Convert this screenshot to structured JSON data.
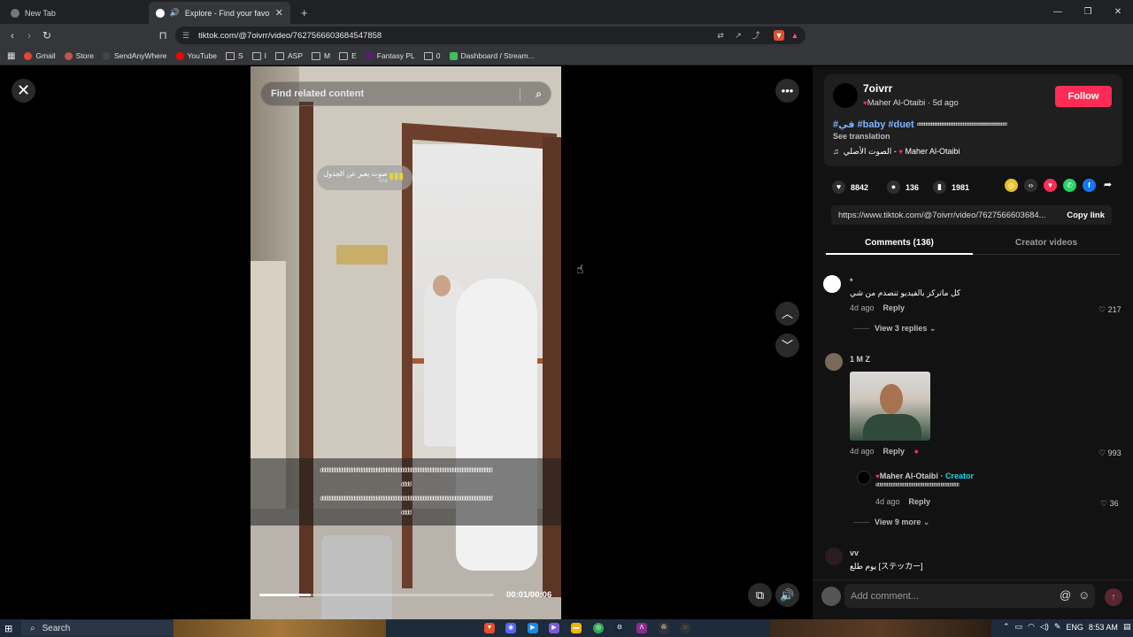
{
  "browser": {
    "tabs": [
      {
        "title": "New Tab"
      },
      {
        "title": "Explore - Find your favourite",
        "close": "✕"
      }
    ],
    "new_tab": "+",
    "url": "tiktok.com/@7oivrr/video/7627566603684547858",
    "bookmarks": [
      "Gmail",
      "Store",
      "SendAnyWhere",
      "YouTube",
      "S",
      "I",
      "ASP",
      "M",
      "E",
      "Fantasy PL",
      "0",
      "Dashboard / Stream..."
    ]
  },
  "video": {
    "search_placeholder": "Find related content",
    "sound_badge_text": "صوت يعبر عن الجدول",
    "sound_badge_sub": "ASA",
    "caption_line1": "ᵈᵈᵈᵈᵈᵈᵈᵈᵈᵈᵈᵈᵈᵈᵈᵈᵈᵈᵈᵈᵈᵈᵈᵈᵈᵈᵈᵈᵈᵈᵈᵈᵈᵈᵈᵈᵈᵈᵈᵈᵈᵈᵈᵈᵈᵈᵈᵈᵈᵈᵈᵈᵈᵈᵈᵈᵈᵈᵈᵈᵈᵈᵈᵈᵈᵈᵈᵈᵈᵈ",
    "caption_line2": "ᵈᵈᵈᵈ",
    "caption_line3": "ᵈᵈᵈᵈᵈᵈᵈᵈᵈᵈᵈᵈᵈᵈᵈᵈᵈᵈᵈᵈᵈᵈᵈᵈᵈᵈᵈᵈᵈᵈᵈᵈᵈᵈᵈᵈᵈᵈᵈᵈᵈᵈᵈᵈᵈᵈᵈᵈᵈᵈᵈᵈᵈᵈᵈᵈᵈᵈᵈᵈᵈᵈᵈᵈᵈᵈᵈᵈᵈᵈ",
    "caption_line4": "ᵈᵈᵈᵈ",
    "time": "00:01/00:06",
    "progress_fraction": 0.22
  },
  "post": {
    "username": "7oivrr",
    "nickname": "Maher Al-Otaibi",
    "age": "5d ago",
    "follow_label": "Follow",
    "hashtags": "#قي #baby #duet",
    "desc_tail": "ᵈᵈᵈᵈᵈᵈᵈᵈᵈᵈᵈᵈᵈᵈᵈᵈᵈᵈᵈᵈᵈᵈᵈᵈᵈᵈᵈᵈᵈᵈᵈᵈᵈᵈᵈᵈᵈᵈᵈᵈᵈᵈᵈᵈᵈᵈᵈᵈᵈᵈ",
    "see_translation": "See translation",
    "music_original": "الصوت الأصلي",
    "music_author": "Maher Al-Otaibi",
    "likes": "8842",
    "comments": "136",
    "saves": "1981",
    "link": "https://www.tiktok.com/@7oivrr/video/7627566603684...",
    "copy_link": "Copy link"
  },
  "tabs": {
    "comments": "Comments (136)",
    "creator": "Creator videos"
  },
  "comments": [
    {
      "name": "*",
      "text": "كل ماتركز بالفيديو تنصدم من شي",
      "age": "4d ago",
      "reply": "Reply",
      "likes": "217",
      "replies": "View 3 replies"
    },
    {
      "name": "1 M Z",
      "age": "4d ago",
      "reply": "Reply",
      "likes": "993"
    },
    {
      "name": "Maher Al-Otaibi",
      "creator_tag": "Creator",
      "text": "ᵈᵈᵈᵈᵈᵈᵈᵈᵈᵈᵈᵈᵈᵈᵈᵈᵈᵈᵈᵈᵈᵈᵈᵈᵈᵈᵈᵈᵈᵈᵈᵈᵈᵈᵈᵈᵈᵈᵈᵈᵈᵈᵈᵈᵈᵈᵈᵈᵈᵈᵈᵈᵈᵈᵈᵈᵈ",
      "age": "4d ago",
      "reply": "Reply",
      "likes": "36",
      "more": "View 9 more"
    },
    {
      "name": "vv",
      "text": "يوم طلع [ステッカー]"
    }
  ],
  "comment_input": {
    "placeholder": "Add comment..."
  },
  "taskbar": {
    "search": "Search",
    "lang": "ENG",
    "time": "8:53 AM"
  }
}
